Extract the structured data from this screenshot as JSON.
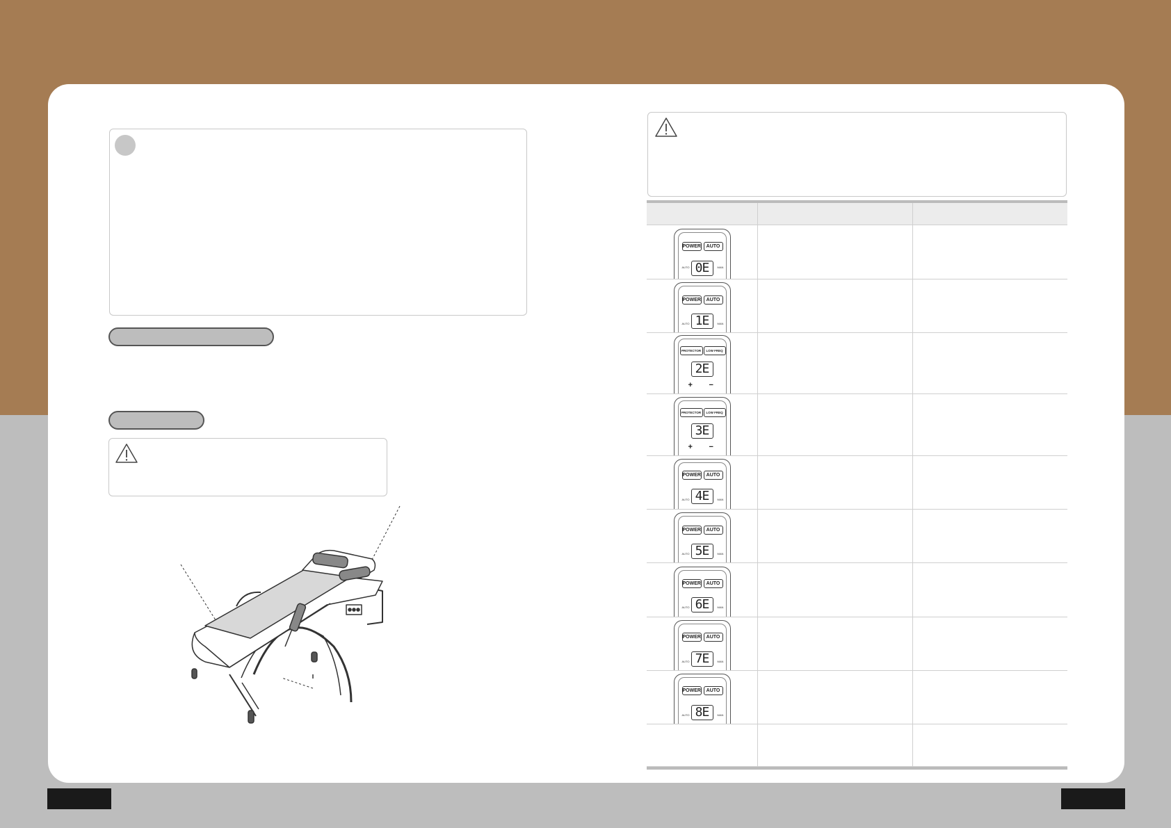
{
  "remote_buttons": {
    "power": "POWER",
    "auto": "AUTO",
    "protector": "PROTECTOR",
    "low_freq": "LOW FREQ",
    "small_left": "AUTO",
    "small_right": "MAN",
    "plus": "+",
    "minus": "−"
  },
  "error_codes": [
    {
      "code": "0E",
      "remote": "standard"
    },
    {
      "code": "1E",
      "remote": "standard"
    },
    {
      "code": "2E",
      "remote": "alt"
    },
    {
      "code": "3E",
      "remote": "alt"
    },
    {
      "code": "4E",
      "remote": "standard"
    },
    {
      "code": "5E",
      "remote": "standard"
    },
    {
      "code": "6E",
      "remote": "standard"
    },
    {
      "code": "7E",
      "remote": "standard"
    },
    {
      "code": "8E",
      "remote": "standard"
    }
  ],
  "colors": {
    "brown_band": "#a57c53",
    "gray_band": "#bdbdbd",
    "page": "#ffffff"
  }
}
